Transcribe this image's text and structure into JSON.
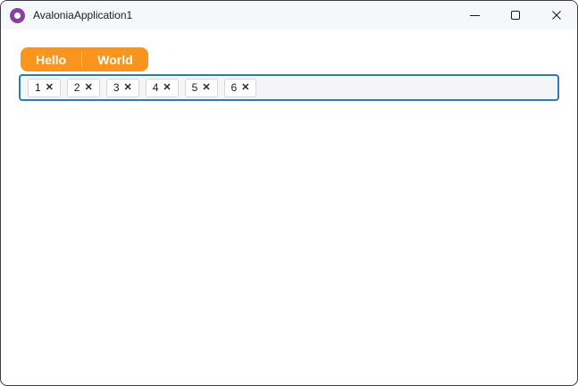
{
  "window": {
    "title": "AvaloniaApplication1",
    "controls": [
      {
        "name": "minimize"
      },
      {
        "name": "maximize"
      },
      {
        "name": "close"
      }
    ]
  },
  "tab_bar": {
    "tabs": [
      {
        "label": "Hello"
      },
      {
        "label": "World"
      }
    ]
  },
  "chip_input": {
    "chips": [
      {
        "label": "1"
      },
      {
        "label": "2"
      },
      {
        "label": "3"
      },
      {
        "label": "4"
      },
      {
        "label": "5"
      },
      {
        "label": "6"
      }
    ],
    "close_glyph": "✕"
  },
  "colors": {
    "accent_orange": "#F9941D",
    "chipbox_border": "#2E7CB5",
    "chipbox_bg": "#F3F5F7",
    "chip_bg": "#FFFFFF",
    "titlebar_bg": "#F5F7FA",
    "window_border": "#3D3D3D",
    "logo_purple": "#8741A3"
  }
}
